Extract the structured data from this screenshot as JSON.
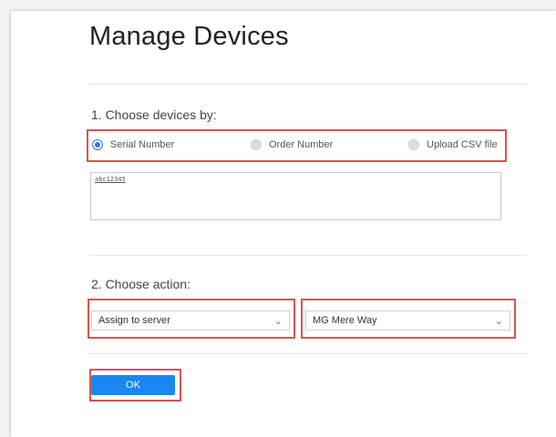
{
  "page": {
    "title": "Manage Devices"
  },
  "step1": {
    "label": "1. Choose devices by:",
    "options": [
      {
        "label": "Serial Number",
        "selected": true
      },
      {
        "label": "Order Number",
        "selected": false
      },
      {
        "label": "Upload CSV file",
        "selected": false
      }
    ],
    "devices_text": "abc12345"
  },
  "step2": {
    "label": "2. Choose action:",
    "action_select": {
      "value": "Assign to server",
      "icon": "chevron-down-icon"
    },
    "server_select": {
      "value": "MG Mere Way",
      "icon": "chevron-down-icon"
    }
  },
  "ok_label": "OK",
  "colors": {
    "highlight": "#d9534f",
    "accent": "#1a88f0",
    "radio_selected": "#2a7ae2"
  }
}
